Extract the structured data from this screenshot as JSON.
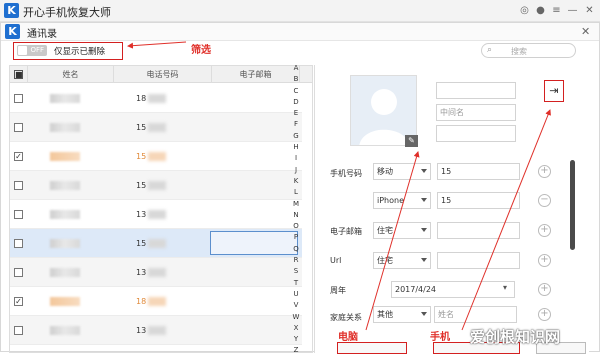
{
  "app": {
    "title": "开心手机恢复大师",
    "logo_letter": "K"
  },
  "dialog": {
    "title": "通讯录",
    "logo_letter": "K"
  },
  "toolbar": {
    "toggle_label": "OFF",
    "filter_label": "仅显示已删除",
    "search_placeholder": "搜索"
  },
  "annotations": {
    "filter": "筛选",
    "pc": "电脑",
    "phone": "手机"
  },
  "list": {
    "columns": [
      "姓名",
      "电话号码",
      "电子邮箱"
    ],
    "rows": [
      {
        "checked": false,
        "phone": "18",
        "highlight": false,
        "selected": false,
        "alt": false
      },
      {
        "checked": false,
        "phone": "15",
        "highlight": false,
        "selected": false,
        "alt": true
      },
      {
        "checked": true,
        "phone": "15",
        "highlight": true,
        "selected": false,
        "alt": false
      },
      {
        "checked": false,
        "phone": "15",
        "highlight": false,
        "selected": false,
        "alt": true
      },
      {
        "checked": false,
        "phone": "13",
        "highlight": false,
        "selected": false,
        "alt": false
      },
      {
        "checked": false,
        "phone": "15",
        "highlight": false,
        "selected": true,
        "alt": false
      },
      {
        "checked": false,
        "phone": "13",
        "highlight": false,
        "selected": false,
        "alt": true
      },
      {
        "checked": true,
        "phone": "18",
        "highlight": true,
        "selected": false,
        "alt": false
      },
      {
        "checked": false,
        "phone": "13",
        "highlight": false,
        "selected": false,
        "alt": true
      },
      {
        "checked": false,
        "phone": "15",
        "highlight": false,
        "selected": false,
        "alt": false
      }
    ],
    "alphabet": [
      "A",
      "B",
      "C",
      "D",
      "E",
      "F",
      "G",
      "H",
      "I",
      "J",
      "K",
      "L",
      "M",
      "N",
      "O",
      "P",
      "Q",
      "R",
      "S",
      "T",
      "U",
      "V",
      "W",
      "X",
      "Y",
      "Z"
    ]
  },
  "detail": {
    "middle_name_placeholder": "中间名",
    "labels": {
      "phone": "手机号码",
      "email": "电子邮箱",
      "url": "Url",
      "anniversary": "周年",
      "relation": "家庭关系"
    },
    "phone_type_1": "移动",
    "phone_value_1": "15",
    "phone_type_2": "iPhone",
    "phone_value_2": "15",
    "email_type": "住宅",
    "url_type": "住宅",
    "anniversary_value": "2017/4/24",
    "relation_type": "其他",
    "relation_placeholder": "姓名"
  },
  "watermark": "爱创根知识网",
  "colors": {
    "annotation_red": "#e0302a",
    "selection_blue": "#dde9f8",
    "brand_blue": "#1f6fd0"
  }
}
